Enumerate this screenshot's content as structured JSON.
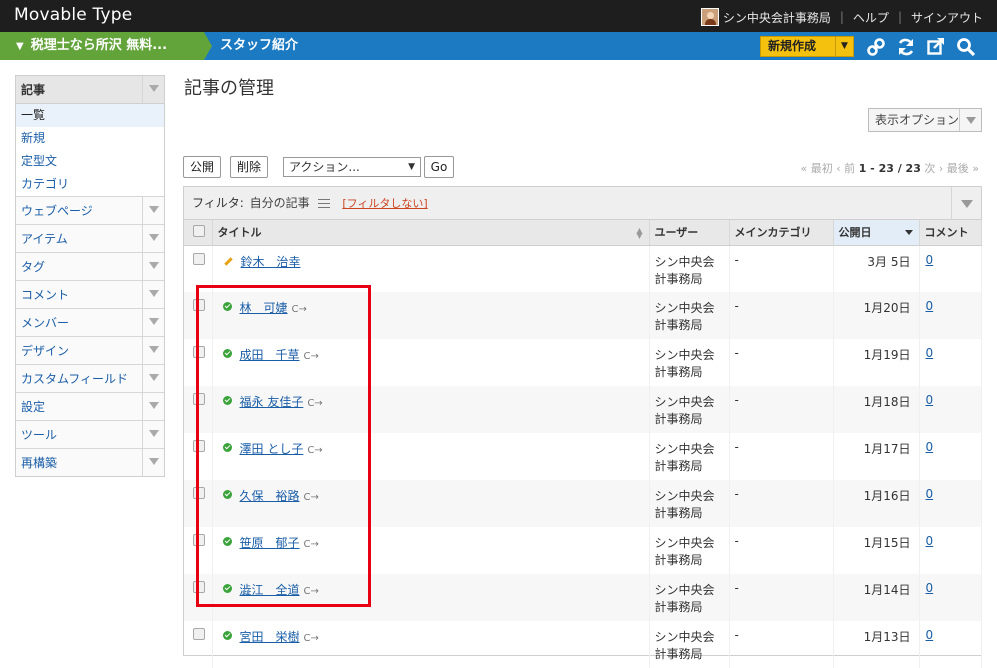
{
  "app": {
    "brand": "Movable Type",
    "user": "シン中央会計事務局",
    "help": "ヘルプ",
    "signout": "サインアウト"
  },
  "nav": {
    "blog_name": "税理士なら所沢 無料...",
    "current_page": "スタッフ紹介",
    "new_button": "新規作成"
  },
  "sidebar": {
    "head": "記事",
    "subitems": [
      {
        "label": "一覧",
        "active": true
      },
      {
        "label": "新規"
      },
      {
        "label": "定型文"
      },
      {
        "label": "カテゴリ"
      }
    ],
    "items": [
      {
        "label": "ウェブページ"
      },
      {
        "label": "アイテム"
      },
      {
        "label": "タグ"
      },
      {
        "label": "コメント"
      },
      {
        "label": "メンバー"
      },
      {
        "label": "デザイン"
      },
      {
        "label": "カスタムフィールド"
      },
      {
        "label": "設定"
      },
      {
        "label": "ツール"
      },
      {
        "label": "再構築"
      }
    ]
  },
  "main": {
    "title": "記事の管理",
    "display_options": "表示オプション",
    "publish_button": "公開",
    "delete_button": "削除",
    "action_select": "アクション...",
    "go_button": "Go",
    "pager": {
      "first": "« 最初",
      "prev": "‹ 前",
      "range": "1 - 23 / 23",
      "next": "次 ›",
      "last": "最後 »"
    },
    "filter": {
      "label": "フィルタ:",
      "name": "自分の記事",
      "clear": "[フィルタしない]"
    },
    "columns": {
      "title": "タイトル",
      "user": "ユーザー",
      "category": "メインカテゴリ",
      "date": "公開日",
      "comments": "コメント"
    },
    "rows": [
      {
        "title": "鈴木　治幸",
        "status": "draft",
        "user": "シン中央会計事務局",
        "category": "-",
        "date": "3月 5日",
        "comments": "0"
      },
      {
        "title": "林　可婕",
        "status": "published",
        "user": "シン中央会計事務局",
        "category": "-",
        "date": "1月20日",
        "comments": "0"
      },
      {
        "title": "成田　千草",
        "status": "published",
        "user": "シン中央会計事務局",
        "category": "-",
        "date": "1月19日",
        "comments": "0"
      },
      {
        "title": "福永 友佳子",
        "status": "published",
        "user": "シン中央会計事務局",
        "category": "-",
        "date": "1月18日",
        "comments": "0"
      },
      {
        "title": "澤田 とし子",
        "status": "published",
        "user": "シン中央会計事務局",
        "category": "-",
        "date": "1月17日",
        "comments": "0"
      },
      {
        "title": "久保　裕路",
        "status": "published",
        "user": "シン中央会計事務局",
        "category": "-",
        "date": "1月16日",
        "comments": "0"
      },
      {
        "title": "笹原　郁子",
        "status": "published",
        "user": "シン中央会計事務局",
        "category": "-",
        "date": "1月15日",
        "comments": "0"
      },
      {
        "title": "澁江　全道",
        "status": "published",
        "user": "シン中央会計事務局",
        "category": "-",
        "date": "1月14日",
        "comments": "0"
      },
      {
        "title": "宮田　栄樹",
        "status": "published",
        "user": "シン中央会計事務局",
        "category": "-",
        "date": "1月13日",
        "comments": "0"
      }
    ]
  },
  "colors": {
    "topbar": "#1e1e1e",
    "bluebar": "#1b7ac2",
    "blog_crumb": "#62a33a",
    "new_button": "#f4c10e",
    "highlight_box": "#e60012"
  }
}
